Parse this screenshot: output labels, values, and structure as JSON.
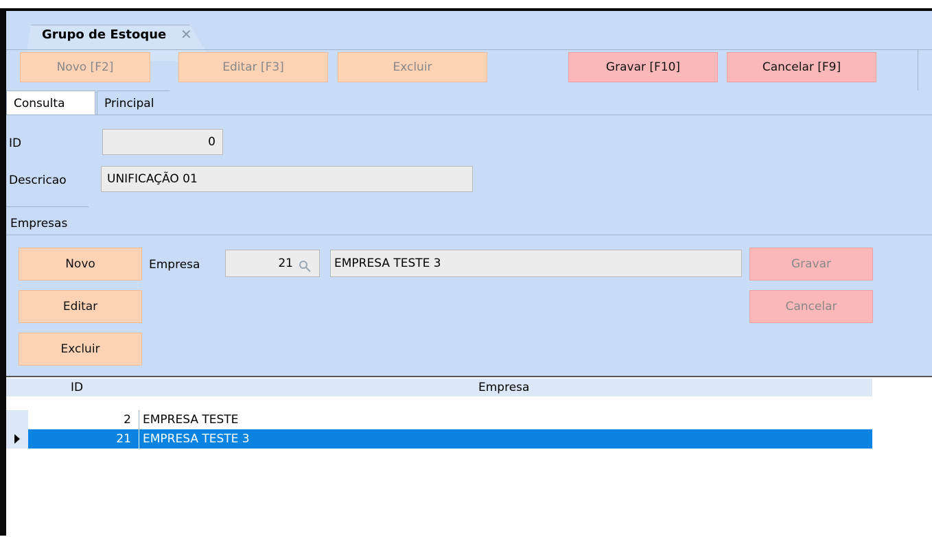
{
  "document_tab": {
    "title": "Grupo de Estoque",
    "close": "✕"
  },
  "toolbar": {
    "novo": "Novo [F2]",
    "editar": "Editar [F3]",
    "excluir": "Excluir",
    "gravar": "Gravar [F10]",
    "cancelar": "Cancelar [F9]"
  },
  "page_tabs": {
    "consulta": "Consulta",
    "principal": "Principal"
  },
  "form": {
    "id_label": "ID",
    "id_value": "0",
    "descricao_label": "Descricao",
    "descricao_value": "UNIFICAÇÃO 01"
  },
  "empresas": {
    "tab_label": "Empresas",
    "novo": "Novo",
    "editar": "Editar",
    "excluir": "Excluir",
    "empresa_label": "Empresa",
    "empresa_id": "21",
    "empresa_name": "EMPRESA TESTE 3",
    "gravar": "Gravar",
    "cancelar": "Cancelar"
  },
  "grid": {
    "columns": {
      "id": "ID",
      "empresa": "Empresa"
    },
    "rows": [
      {
        "id": "2",
        "empresa": "EMPRESA TESTE",
        "selected": false
      },
      {
        "id": "21",
        "empresa": "EMPRESA TESTE 3",
        "selected": true
      }
    ]
  },
  "colors": {
    "panel": "#c8dcf5",
    "peach_button": "#fdd2b5",
    "pink_button": "#fcb8b8",
    "selection": "#0a84e0"
  },
  "icons": {
    "search": "magnifier-icon",
    "row_indicator": "row-pointer-icon"
  }
}
